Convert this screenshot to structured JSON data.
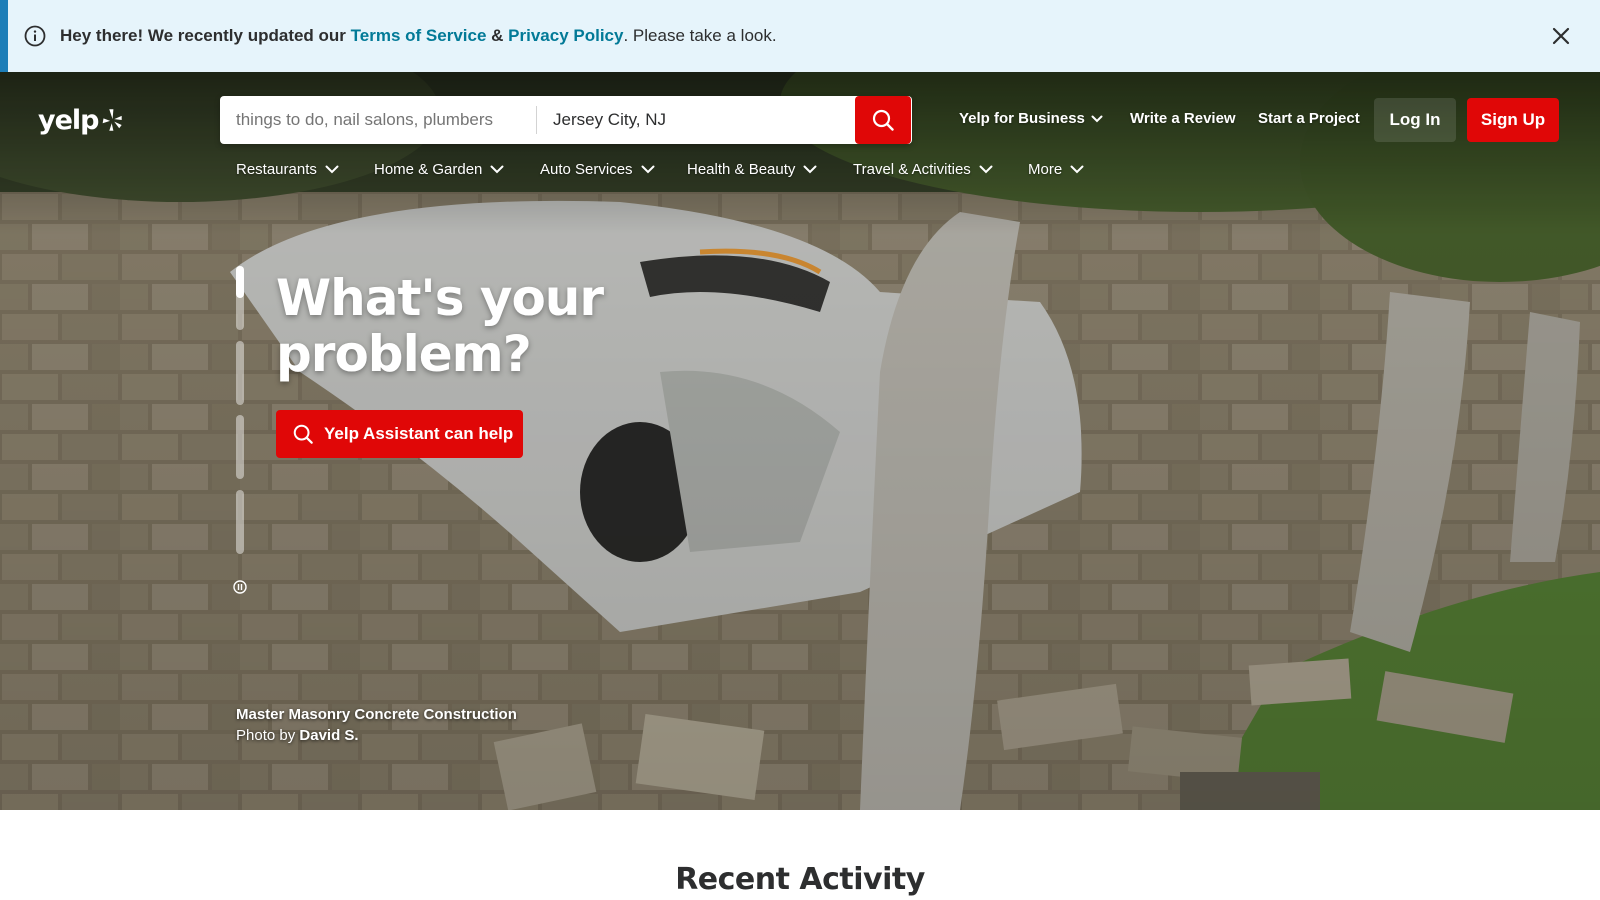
{
  "notice": {
    "greeting": "Hey there! We recently updated our",
    "terms_link": "Terms of Service",
    "amp": "&",
    "privacy_link": "Privacy Policy",
    "trail": ". Please take a look.",
    "icon": "info-icon",
    "close_icon": "close-icon"
  },
  "header": {
    "logo_text": "yelp",
    "search": {
      "find_placeholder": "things to do, nail salons, plumbers",
      "find_value": "",
      "near_value": "Jersey City, NJ",
      "button_icon": "search-icon"
    },
    "links": {
      "business": "Yelp for Business",
      "review": "Write a Review",
      "project": "Start a Project"
    },
    "login": "Log In",
    "signup": "Sign Up"
  },
  "categories": [
    {
      "label": "Restaurants"
    },
    {
      "label": "Home & Garden"
    },
    {
      "label": "Auto Services"
    },
    {
      "label": "Health & Beauty"
    },
    {
      "label": "Travel & Activities"
    },
    {
      "label": "More"
    }
  ],
  "hero": {
    "headline_line1": "What's your",
    "headline_line2": "problem?",
    "cta": "Yelp Assistant can help",
    "slide_progress": [
      0.5,
      0,
      0,
      0
    ],
    "business_name": "Master Masonry Concrete Construction",
    "photo_by": "Photo by",
    "photographer": "David S."
  },
  "section": {
    "title": "Recent Activity"
  },
  "colors": {
    "brand_red": "#e00707",
    "link_teal": "#027a97",
    "notice_bg": "#e6f4fb"
  }
}
